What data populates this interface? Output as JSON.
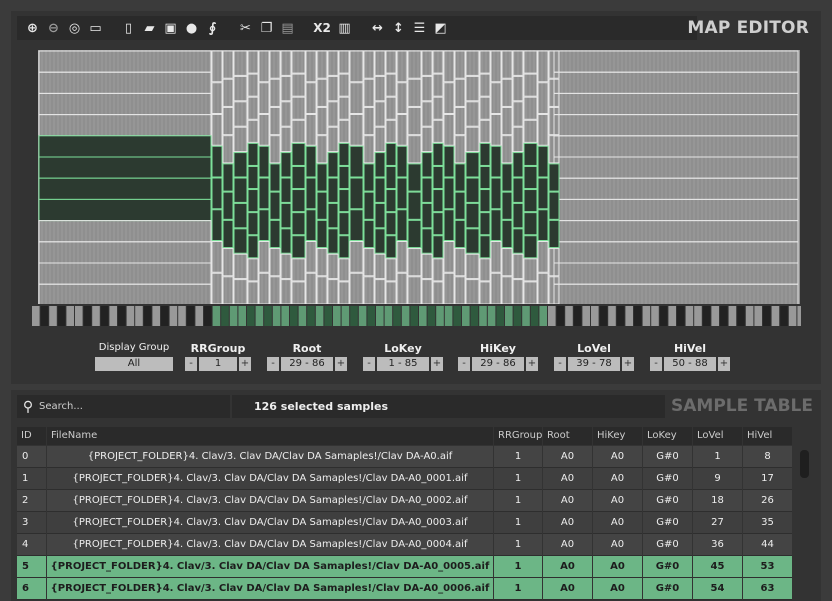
{
  "map_editor": {
    "title": "MAP EDITOR",
    "toolbar": {
      "x2_label": "X2",
      "icons": [
        "zoom-in-icon",
        "zoom-out-icon",
        "headphones-icon",
        "comment-icon",
        "new-file-icon",
        "open-folder-icon",
        "save-icon",
        "download-icon",
        "script-icon",
        "cut-icon",
        "copy-icon",
        "paste-icon",
        "trash-icon",
        "horizontal-resize-icon",
        "vertical-resize-icon",
        "lines-icon",
        "diagonal-icon"
      ]
    },
    "selected_color": "#7de09a",
    "controls": [
      {
        "key": "display_group",
        "label": "Display Group",
        "value": "All"
      },
      {
        "key": "rrgroup",
        "label": "RRGroup",
        "value": "1"
      },
      {
        "key": "root",
        "label": "Root",
        "value": "29 - 86"
      },
      {
        "key": "lokey",
        "label": "LoKey",
        "value": "1 - 85"
      },
      {
        "key": "hikey",
        "label": "HiKey",
        "value": "29 - 86"
      },
      {
        "key": "lovel",
        "label": "LoVel",
        "value": "39 - 78"
      },
      {
        "key": "hivel",
        "label": "HiVel",
        "value": "50 - 88"
      }
    ],
    "stepper": {
      "minus": "-",
      "plus": "+"
    }
  },
  "sample_table": {
    "title": "SAMPLE TABLE",
    "search_placeholder": "Search...",
    "selection_text": "126 selected samples",
    "columns": [
      "ID",
      "FileName",
      "RRGroup",
      "Root",
      "HiKey",
      "LoKey",
      "LoVel",
      "HiVel"
    ],
    "rows": [
      {
        "id": "0",
        "file": "{PROJECT_FOLDER}4. Clav/3. Clav DA/Clav DA Samaples!/Clav DA-A0.aif",
        "rr": "1",
        "root": "A0",
        "hikey": "A0",
        "lokey": "G#0",
        "lovel": "1",
        "hivel": "8",
        "selected": false
      },
      {
        "id": "1",
        "file": "{PROJECT_FOLDER}4. Clav/3. Clav DA/Clav DA Samaples!/Clav DA-A0_0001.aif",
        "rr": "1",
        "root": "A0",
        "hikey": "A0",
        "lokey": "G#0",
        "lovel": "9",
        "hivel": "17",
        "selected": false
      },
      {
        "id": "2",
        "file": "{PROJECT_FOLDER}4. Clav/3. Clav DA/Clav DA Samaples!/Clav DA-A0_0002.aif",
        "rr": "1",
        "root": "A0",
        "hikey": "A0",
        "lokey": "G#0",
        "lovel": "18",
        "hivel": "26",
        "selected": false
      },
      {
        "id": "3",
        "file": "{PROJECT_FOLDER}4. Clav/3. Clav DA/Clav DA Samaples!/Clav DA-A0_0003.aif",
        "rr": "1",
        "root": "A0",
        "hikey": "A0",
        "lokey": "G#0",
        "lovel": "27",
        "hivel": "35",
        "selected": false
      },
      {
        "id": "4",
        "file": "{PROJECT_FOLDER}4. Clav/3. Clav DA/Clav DA Samaples!/Clav DA-A0_0004.aif",
        "rr": "1",
        "root": "A0",
        "hikey": "A0",
        "lokey": "G#0",
        "lovel": "36",
        "hivel": "44",
        "selected": false
      },
      {
        "id": "5",
        "file": "{PROJECT_FOLDER}4. Clav/3. Clav DA/Clav DA Samaples!/Clav DA-A0_0005.aif",
        "rr": "1",
        "root": "A0",
        "hikey": "A0",
        "lokey": "G#0",
        "lovel": "45",
        "hivel": "53",
        "selected": true
      },
      {
        "id": "6",
        "file": "{PROJECT_FOLDER}4. Clav/3. Clav DA/Clav DA Samaples!/Clav DA-A0_0006.aif",
        "rr": "1",
        "root": "A0",
        "hikey": "A0",
        "lokey": "G#0",
        "lovel": "54",
        "hivel": "63",
        "selected": true
      }
    ]
  }
}
